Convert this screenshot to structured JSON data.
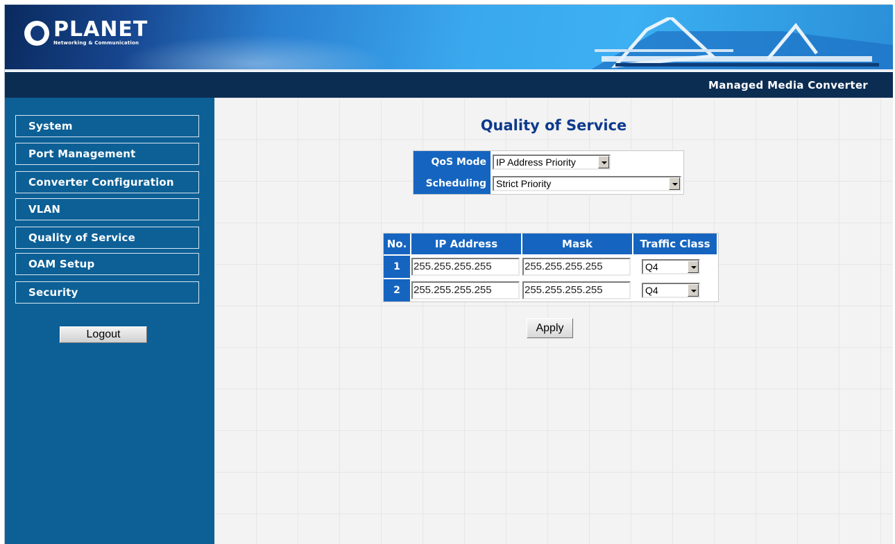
{
  "header": {
    "brand": "PLANET",
    "brand_tagline": "Networking & Communication",
    "product": "Managed Media Converter"
  },
  "sidebar": {
    "items": [
      {
        "label": "System"
      },
      {
        "label": "Port Management"
      },
      {
        "label": "Converter Configuration"
      },
      {
        "label": "VLAN"
      },
      {
        "label": "Quality of Service"
      },
      {
        "label": "OAM Setup"
      },
      {
        "label": "Security"
      }
    ],
    "logout_label": "Logout"
  },
  "main": {
    "title": "Quality of Service",
    "qos_mode": {
      "label": "QoS Mode",
      "value": "IP Address Priority"
    },
    "scheduling": {
      "label": "Scheduling",
      "value": "Strict Priority"
    },
    "table": {
      "headers": {
        "no": "No.",
        "ip": "IP Address",
        "mask": "Mask",
        "traffic_class": "Traffic Class"
      },
      "rows": [
        {
          "no": "1",
          "ip": "255.255.255.255",
          "mask": "255.255.255.255",
          "traffic_class": "Q4"
        },
        {
          "no": "2",
          "ip": "255.255.255.255",
          "mask": "255.255.255.255",
          "traffic_class": "Q4"
        }
      ]
    },
    "apply_label": "Apply"
  },
  "colors": {
    "sidebar_bg": "#0c6096",
    "title_bar_bg": "#0c2d52",
    "header_cell_bg": "#1565c0",
    "page_title": "#0d3a8c"
  }
}
